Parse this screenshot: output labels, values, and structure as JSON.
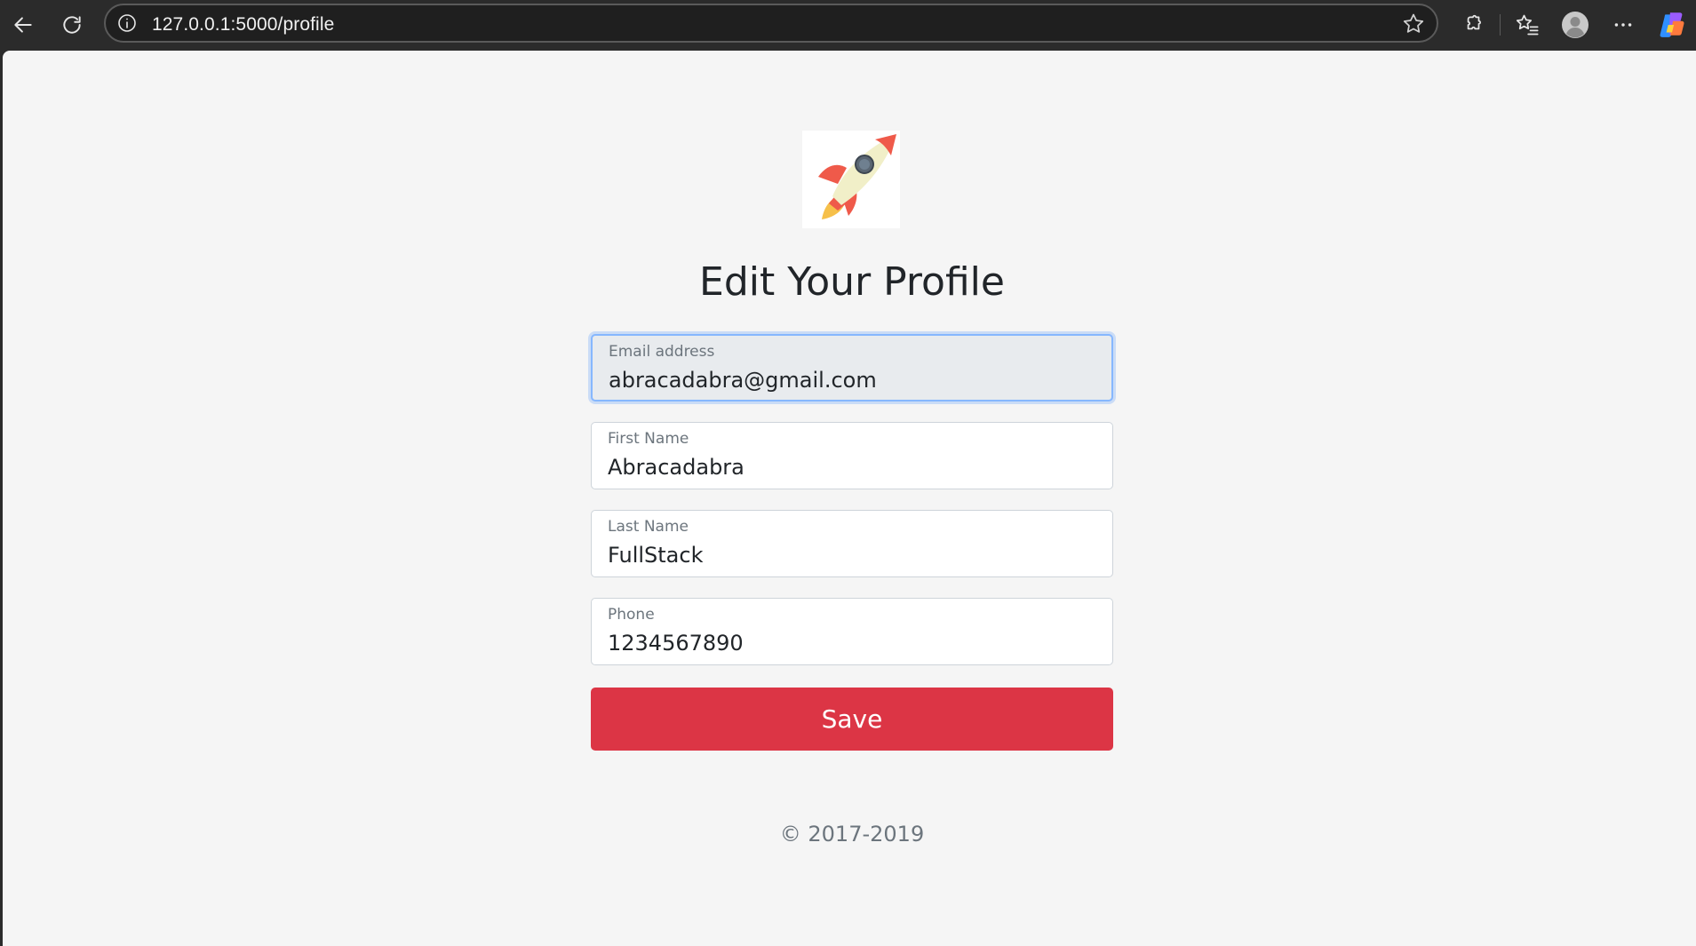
{
  "browser": {
    "url": "127.0.0.1:5000/profile",
    "icons": [
      "back-arrow-icon",
      "refresh-icon",
      "site-info-icon",
      "favorite-star-icon",
      "extensions-icon",
      "favorites-icon",
      "profile-avatar-icon",
      "more-options-icon",
      "copilot-icon"
    ]
  },
  "page": {
    "logo_icon": "rocket-icon",
    "title": "Edit Your Profile",
    "fields": [
      {
        "label": "Email address",
        "value": "abracadabra@gmail.com",
        "focused": true
      },
      {
        "label": "First Name",
        "value": "Abracadabra"
      },
      {
        "label": "Last Name",
        "value": "FullStack"
      },
      {
        "label": "Phone",
        "value": "1234567890"
      }
    ],
    "save_label": "Save",
    "footer": "© 2017-2019"
  },
  "colors": {
    "save_button": "#dc3545",
    "page_background": "#f5f5f5",
    "toolbar_background": "#2b2b2b",
    "focus_border": "#86b7fe"
  }
}
